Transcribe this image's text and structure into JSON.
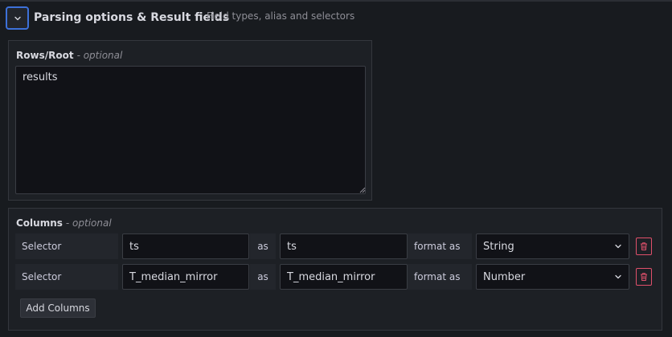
{
  "section": {
    "title": "Parsing options & Result fields",
    "description": "Field types, alias and selectors"
  },
  "rows_root": {
    "label": "Rows/Root",
    "optional": "- optional",
    "value": "results"
  },
  "columns": {
    "label": "Columns",
    "optional": "- optional",
    "selector_label": "Selector",
    "as_label": "as",
    "format_label": "format as",
    "rows": [
      {
        "selector": "ts",
        "alias": "ts",
        "format": "String"
      },
      {
        "selector": "T_median_mirror",
        "alias": "T_median_mirror",
        "format": "Number"
      }
    ],
    "add_button": "Add Columns"
  },
  "colors": {
    "focus_border": "#3d71d9",
    "danger": "#e0506b",
    "background": "#181b1f"
  },
  "icons": {
    "collapse": "chevron-down-icon",
    "select": "chevron-down-icon",
    "delete": "trash-icon"
  }
}
